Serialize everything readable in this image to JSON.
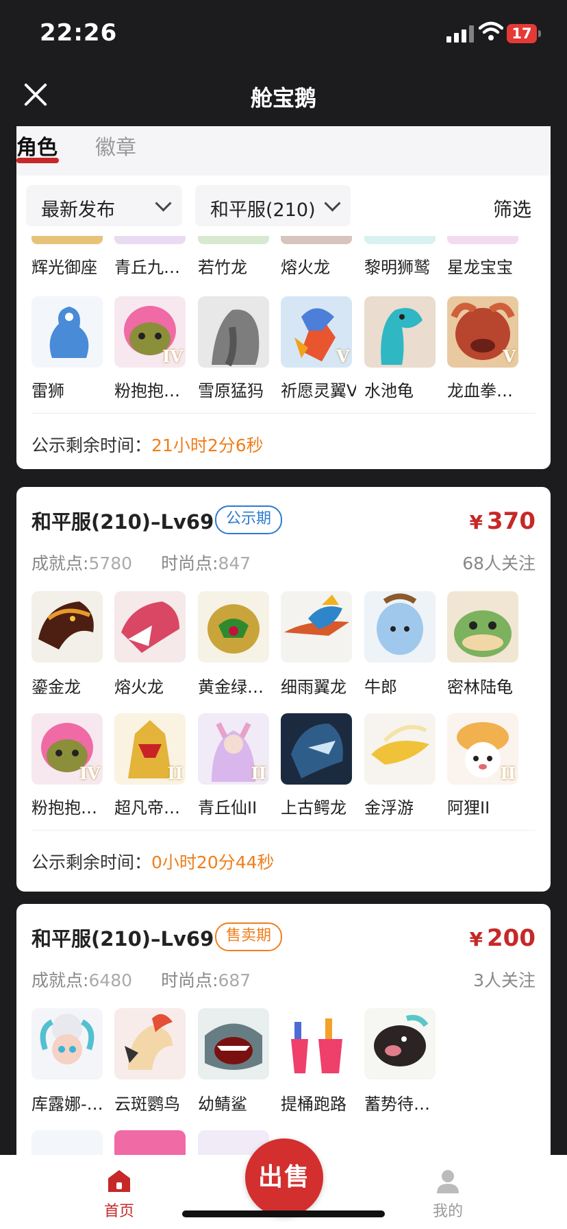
{
  "status": {
    "time": "22:26",
    "battery": "17"
  },
  "nav": {
    "title": "舱宝鹅"
  },
  "tabs": {
    "active": "角色",
    "inactive": "徽章"
  },
  "filters": {
    "sort": "最新发布",
    "server": "和平服(210)",
    "filter_label": "筛选"
  },
  "card1": {
    "row1_labels": [
      "辉光御座",
      "青丘九…",
      "若竹龙",
      "熔火龙",
      "黎明狮鹫",
      "星龙宝宝"
    ],
    "row2_labels": [
      "雷狮",
      "粉抱抱…",
      "雪原猛犸",
      "祈愿灵翼V",
      "水池龟",
      "龙血拳…"
    ],
    "row2_ranks": [
      "",
      "IV",
      "",
      "V",
      "",
      "V"
    ],
    "timer_label": "公示剩余时间：",
    "timer_value": "21小时2分6秒"
  },
  "card2": {
    "title": "和平服(210)–Lv69",
    "badge": "公示期",
    "price_symbol": "¥",
    "price": "370",
    "achieve_label": "成就点:",
    "achieve_value": "5780",
    "fashion_label": "时尚点:",
    "fashion_value": "847",
    "follows": "68人关注",
    "row1_labels": [
      "鎏金龙",
      "熔火龙",
      "黄金绿…",
      "细雨翼龙",
      "牛郎",
      "密林陆龟"
    ],
    "row2_labels": [
      "粉抱抱…",
      "超凡帝…",
      "青丘仙II",
      "上古鳄龙",
      "金浮游",
      "阿狸II"
    ],
    "row2_ranks": [
      "IV",
      "II",
      "II",
      "",
      "",
      "II"
    ],
    "timer_label": "公示剩余时间：",
    "timer_value": "0小时20分44秒"
  },
  "card3": {
    "title": "和平服(210)–Lv69",
    "badge": "售卖期",
    "price_symbol": "¥",
    "price": "200",
    "achieve_label": "成就点:",
    "achieve_value": "6480",
    "fashion_label": "时尚点:",
    "fashion_value": "687",
    "follows": "3人关注",
    "row1_labels": [
      "库露娜-…",
      "云斑鹦鸟",
      "幼鲭鲨",
      "提桶跑路",
      "蓄势待…"
    ]
  },
  "bottom": {
    "home_label": "首页",
    "sell_label": "出售",
    "me_label": "我的"
  },
  "colors": {
    "accent": "#c62828",
    "timer": "#f07e1c",
    "badge_blue": "#2b7bd0",
    "badge_orange": "#f07e1c"
  }
}
